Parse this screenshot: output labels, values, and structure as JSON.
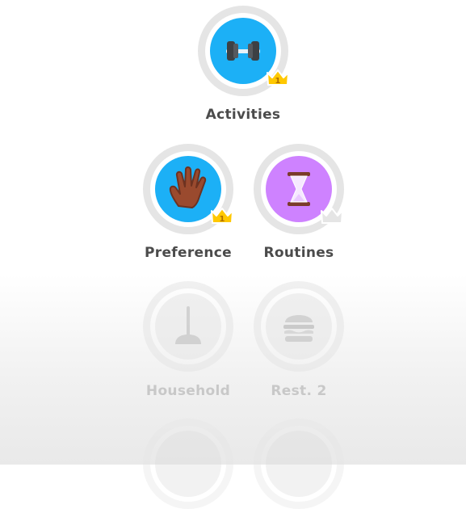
{
  "skills": [
    {
      "name": "Activities",
      "icon": "dumbbell-icon",
      "level": "1",
      "state": "unlocked",
      "color": "#1cb0f6"
    },
    {
      "name": "Preference",
      "icon": "hand-icon",
      "level": "1",
      "state": "unlocked",
      "color": "#1cb0f6"
    },
    {
      "name": "Routines",
      "icon": "hourglass-icon",
      "level": "",
      "state": "unlocked",
      "color": "#ce82ff"
    },
    {
      "name": "Household",
      "icon": "plunger-icon",
      "level": "",
      "state": "locked",
      "color": "#e5e5e5"
    },
    {
      "name": "Rest. 2",
      "icon": "burger-icon",
      "level": "",
      "state": "locked",
      "color": "#e5e5e5"
    }
  ],
  "colors": {
    "label": "#4b4b4b",
    "label_locked": "#c8c8c8",
    "crown": "#ffc800"
  }
}
